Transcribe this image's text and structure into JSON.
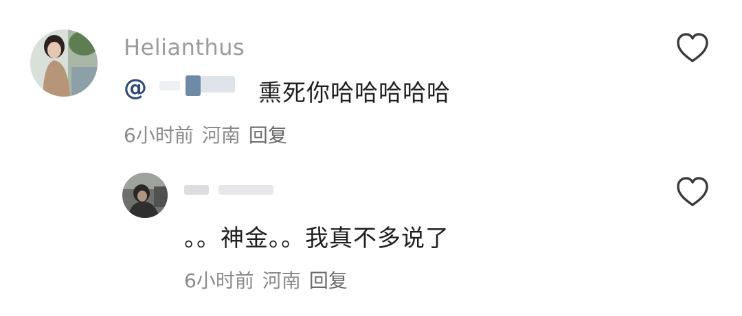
{
  "comments": [
    {
      "username": "Helianthus",
      "mention_symbol": "@",
      "text": "熏死你哈哈哈哈哈",
      "time": "6小时前",
      "location": "河南",
      "reply_label": "回复",
      "like_icon": "heart-outline-icon"
    },
    {
      "username": "",
      "text": "。。神金。。我真不多说了",
      "time": "6小时前",
      "location": "河南",
      "reply_label": "回复",
      "like_icon": "heart-outline-icon"
    }
  ],
  "colors": {
    "username": "#9b9b9b",
    "text": "#1f1f1f",
    "mention": "#2f4a74",
    "meta": "#8a8a8a"
  }
}
